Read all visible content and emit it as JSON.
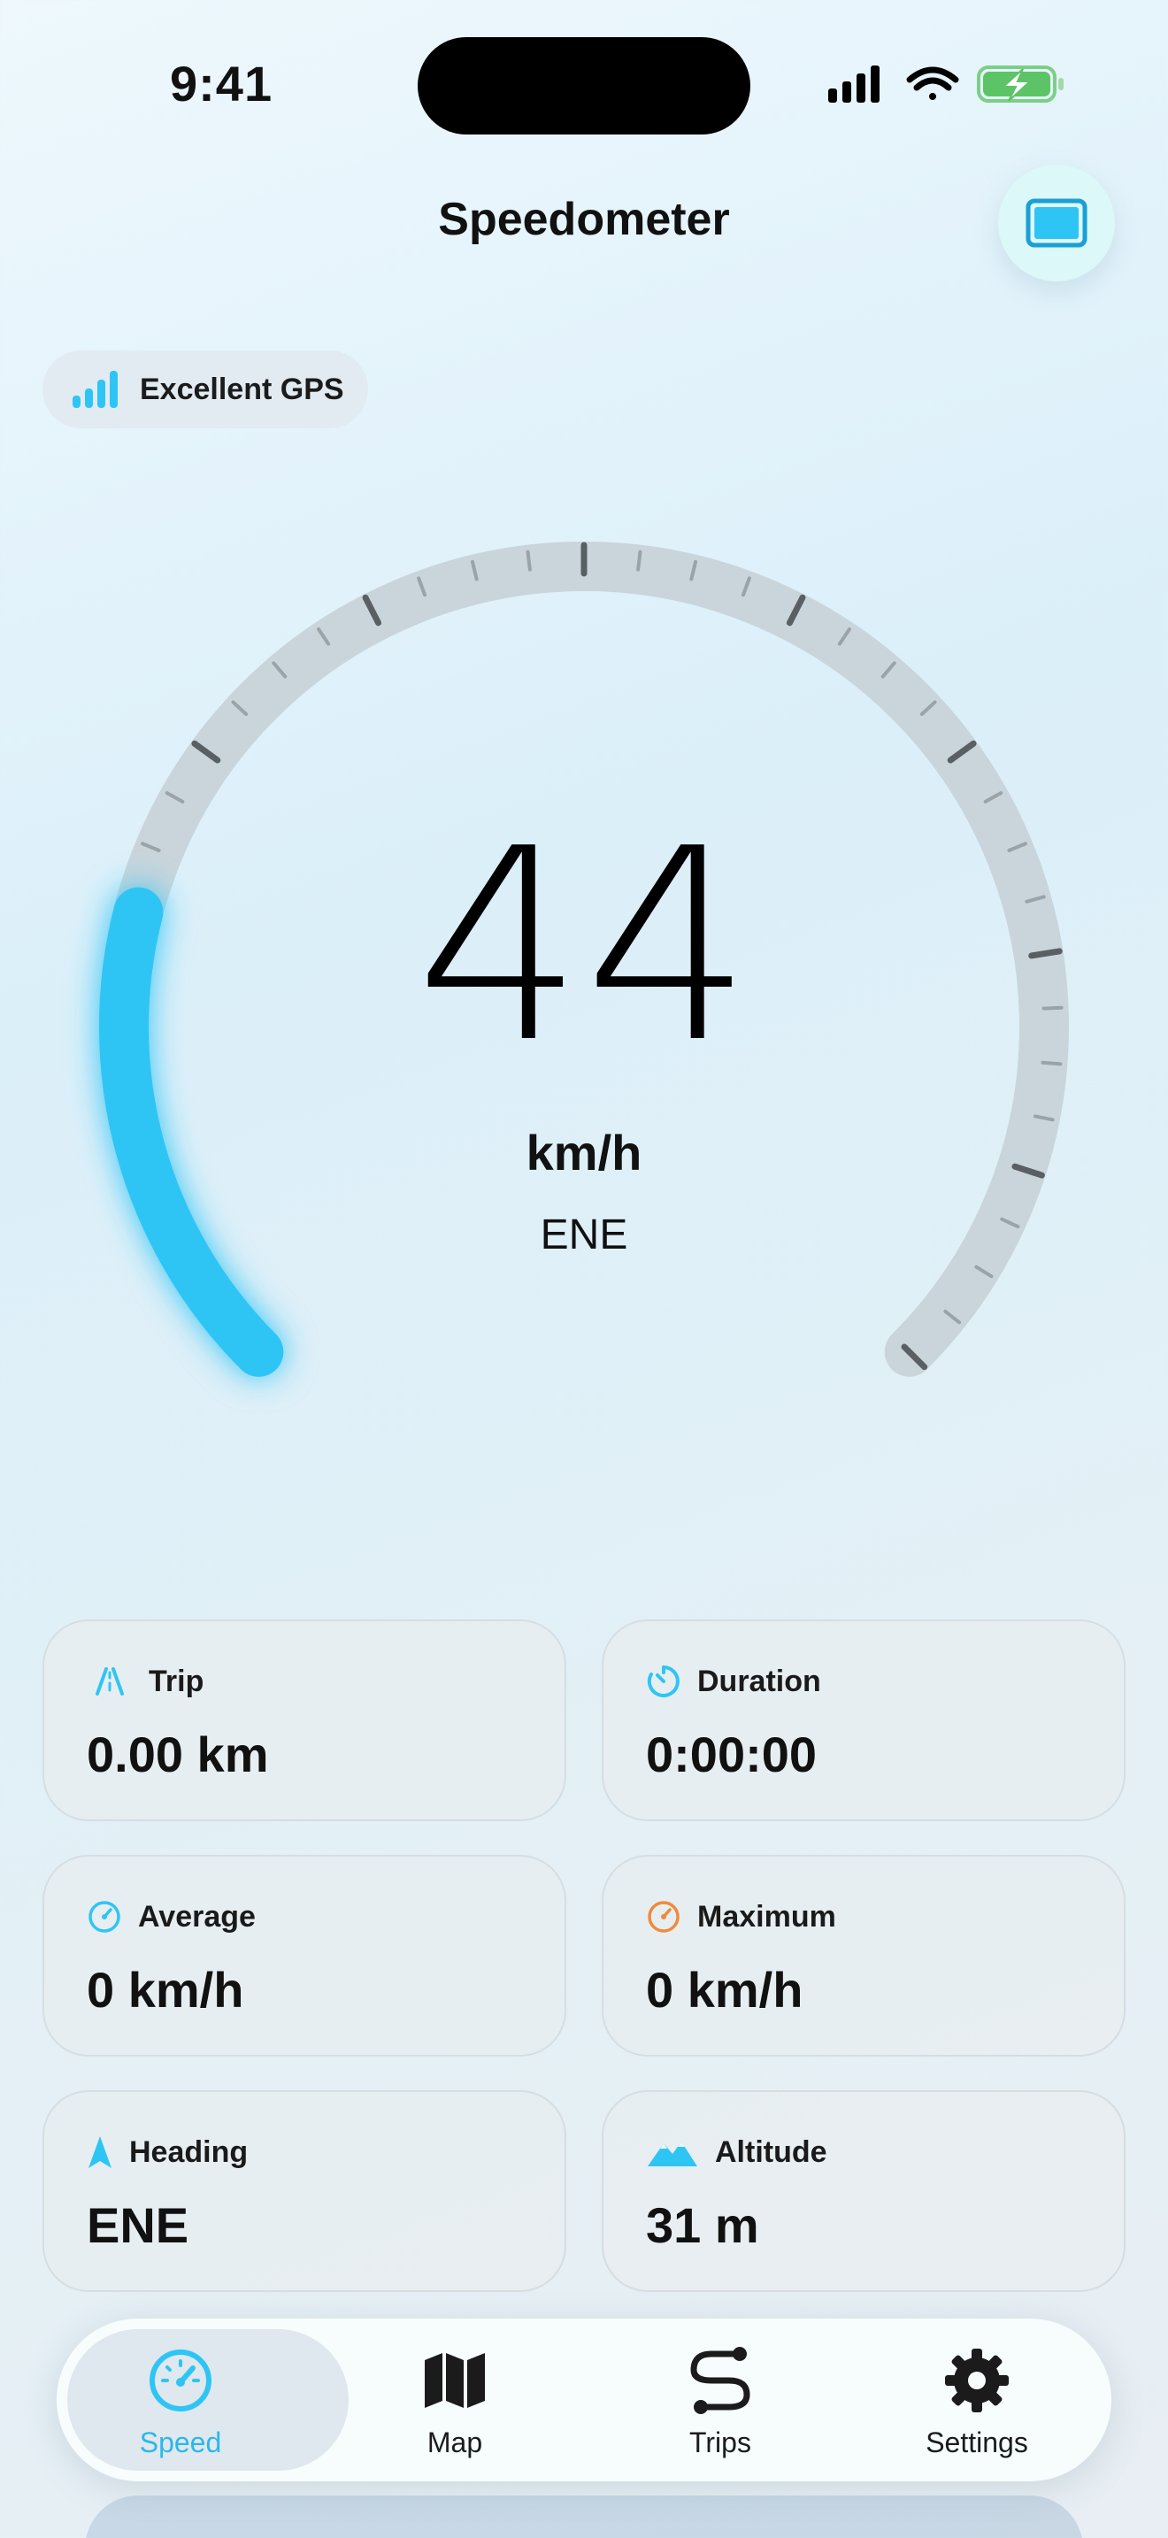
{
  "status_bar": {
    "time": "9:41"
  },
  "header": {
    "title": "Speedometer"
  },
  "gps": {
    "label": "Excellent GPS"
  },
  "speedometer": {
    "speed": "44",
    "unit": "km/h",
    "heading": "ENE",
    "max_speed": 200,
    "current_speed": 44
  },
  "stats": {
    "trip": {
      "label": "Trip",
      "value": "0.00 km"
    },
    "duration": {
      "label": "Duration",
      "value": "0:00:00"
    },
    "average": {
      "label": "Average",
      "value": "0 km/h"
    },
    "maximum": {
      "label": "Maximum",
      "value": "0 km/h"
    },
    "heading": {
      "label": "Heading",
      "value": "ENE"
    },
    "altitude": {
      "label": "Altitude",
      "value": "31 m"
    }
  },
  "tabbar": {
    "speed": "Speed",
    "map": "Map",
    "trips": "Trips",
    "settings": "Settings",
    "active": "speed"
  },
  "colors": {
    "accent": "#2ec5f5",
    "track": "#c9d5db",
    "tick": "#5a5f63",
    "orange": "#f08a3c"
  },
  "icons": {
    "gps": "signal-bars-icon",
    "screen": "screen-mirror-icon",
    "trip": "road-icon",
    "duration": "timer-icon",
    "average": "gauge-icon",
    "maximum": "gauge-icon",
    "heading": "location-arrow-icon",
    "altitude": "mountains-icon"
  }
}
